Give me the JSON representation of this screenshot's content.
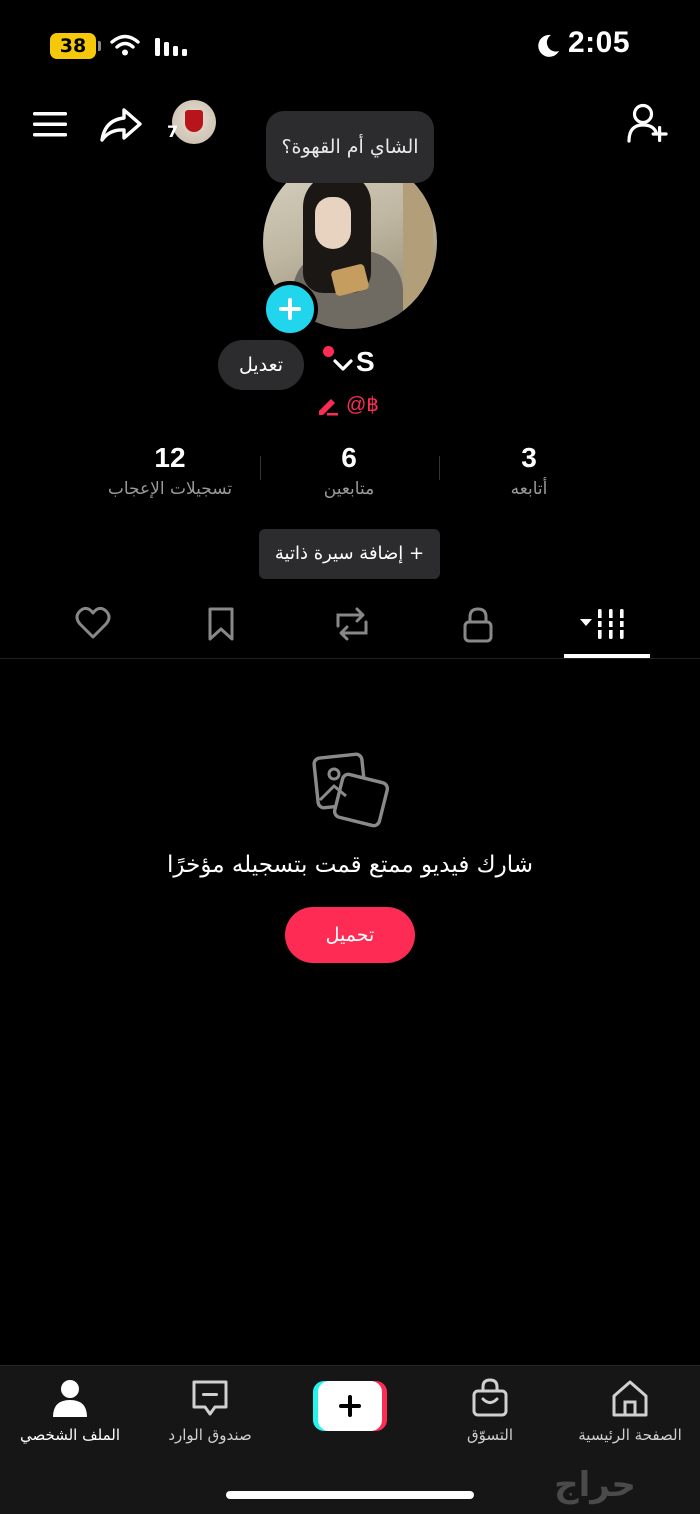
{
  "status_bar": {
    "battery": "38",
    "time": "2:05"
  },
  "top_bar": {
    "avatar_badge": "7"
  },
  "tooltip": "الشاي أم القهوة؟",
  "profile": {
    "display_name": "S",
    "username": "@฿",
    "edit_label": "تعديل"
  },
  "stats": {
    "likes": {
      "value": "12",
      "label": "تسجيلات الإعجاب"
    },
    "followers": {
      "value": "6",
      "label": "متابعين"
    },
    "following": {
      "value": "3",
      "label": "أتابعه"
    }
  },
  "bio_button": "+  إضافة سيرة ذاتية",
  "tabs": {
    "selected": "videos",
    "items": [
      "likes-icon",
      "bookmark-icon",
      "repost-icon",
      "lock-icon",
      "videos-grid-icon"
    ]
  },
  "empty_state": {
    "title": "شارك فيديو ممتع قمت بتسجيله مؤخرًا",
    "button": "تحميل"
  },
  "bottom_nav": {
    "home": "الصفحة الرئيسية",
    "shop": "التسوّق",
    "inbox": "صندوق الوارد",
    "profile": "الملف الشخصي"
  },
  "watermark": "حراج",
  "colors": {
    "accent_pink": "#fe2c55",
    "accent_cyan": "#20d5ec",
    "battery_yellow": "#f5c90a",
    "surface": "#2c2c2e"
  }
}
